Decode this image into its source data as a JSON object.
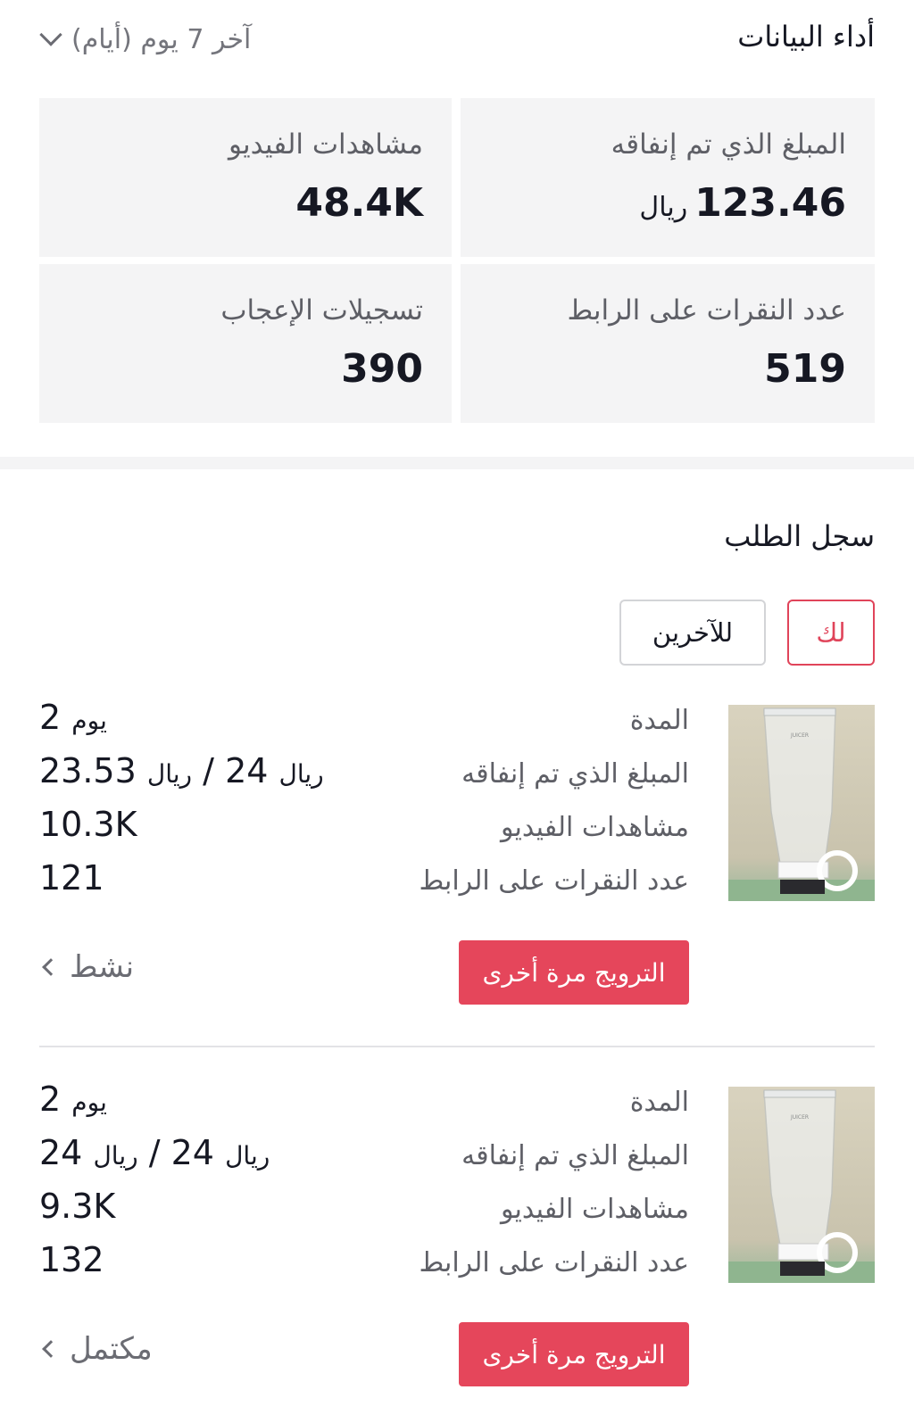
{
  "performance": {
    "title": "أداء البيانات",
    "range_label": "آخر 7 يوم (أيام)",
    "stats": [
      {
        "label": "المبلغ الذي تم إنفاقه",
        "value": "123.46",
        "unit": "ريال"
      },
      {
        "label": "مشاهدات الفيديو",
        "value": "48.4K",
        "unit": ""
      },
      {
        "label": "عدد النقرات على الرابط",
        "value": "519",
        "unit": ""
      },
      {
        "label": "تسجيلات الإعجاب",
        "value": "390",
        "unit": ""
      }
    ]
  },
  "orders": {
    "title": "سجل الطلب",
    "tabs": [
      {
        "label": "لك",
        "active": true
      },
      {
        "label": "للآخرين",
        "active": false
      }
    ],
    "row_labels": {
      "duration": "المدة",
      "spent": "المبلغ الذي تم إنفاقه",
      "views": "مشاهدات الفيديو",
      "clicks": "عدد النقرات على الرابط"
    },
    "currency": "ريال",
    "promote_label": "الترويج مرة أخرى",
    "items": [
      {
        "duration_value": "2",
        "duration_unit": "يوم",
        "spent": "23.53",
        "budget": "24",
        "views": "10.3K",
        "clicks": "121",
        "status": "نشط"
      },
      {
        "duration_value": "2",
        "duration_unit": "يوم",
        "spent": "24",
        "budget": "24",
        "views": "9.3K",
        "clicks": "132",
        "status": "مكتمل"
      }
    ]
  },
  "colors": {
    "accent": "#e5465b",
    "card_bg": "#f4f4f5",
    "text_primary": "#161823",
    "text_secondary": "#5e5f66"
  }
}
